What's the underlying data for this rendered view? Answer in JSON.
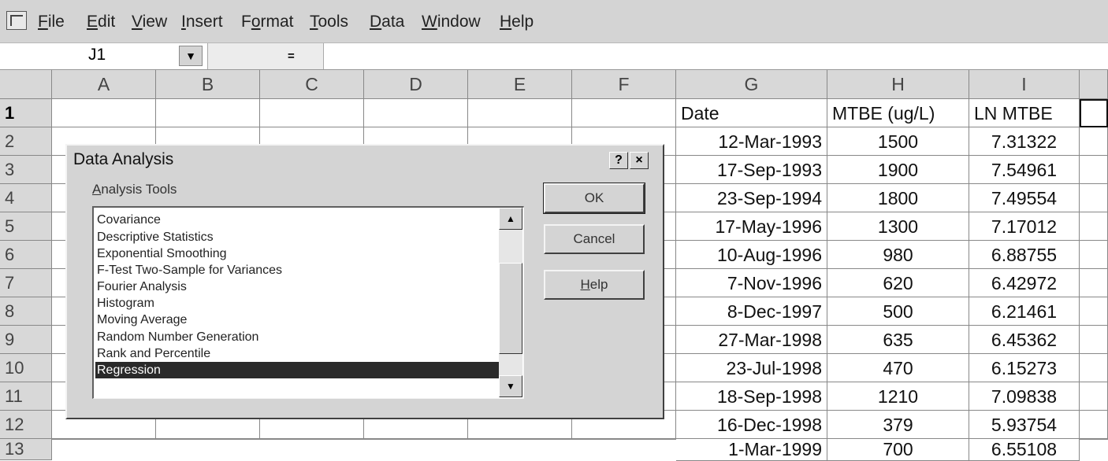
{
  "menubar": {
    "items": [
      "File",
      "Edit",
      "View",
      "Insert",
      "Format",
      "Tools",
      "Data",
      "Window",
      "Help"
    ],
    "mnemonics": [
      "F",
      "E",
      "V",
      "I",
      "o",
      "T",
      "D",
      "W",
      "H"
    ]
  },
  "formula_bar": {
    "name_box": "J1",
    "equals": "=",
    "value": ""
  },
  "grid": {
    "columns": [
      "A",
      "B",
      "C",
      "D",
      "E",
      "F",
      "G",
      "H",
      "I"
    ],
    "rows": [
      "1",
      "2",
      "3",
      "4",
      "5",
      "6",
      "7",
      "8",
      "9",
      "10",
      "11",
      "12",
      "13"
    ],
    "header_row": [
      "Date",
      "MTBE (ug/L)",
      "LN MTBE"
    ],
    "data": [
      [
        "12-Mar-1993",
        "1500",
        "7.31322"
      ],
      [
        "17-Sep-1993",
        "1900",
        "7.54961"
      ],
      [
        "23-Sep-1994",
        "1800",
        "7.49554"
      ],
      [
        "17-May-1996",
        "1300",
        "7.17012"
      ],
      [
        "10-Aug-1996",
        "980",
        "6.88755"
      ],
      [
        "7-Nov-1996",
        "620",
        "6.42972"
      ],
      [
        "8-Dec-1997",
        "500",
        "6.21461"
      ],
      [
        "27-Mar-1998",
        "635",
        "6.45362"
      ],
      [
        "23-Jul-1998",
        "470",
        "6.15273"
      ],
      [
        "18-Sep-1998",
        "1210",
        "7.09838"
      ],
      [
        "16-Dec-1998",
        "379",
        "5.93754"
      ],
      [
        "1-Mar-1999",
        "700",
        "6.55108"
      ]
    ]
  },
  "dialog": {
    "title": "Data Analysis",
    "help_button": "?",
    "close_button": "×",
    "list_label": "Analysis Tools",
    "tools": [
      "Covariance",
      "Descriptive Statistics",
      "Exponential Smoothing",
      "F-Test Two-Sample for Variances",
      "Fourier Analysis",
      "Histogram",
      "Moving Average",
      "Random Number Generation",
      "Rank and Percentile",
      "Regression"
    ],
    "selected_tool": "Regression",
    "ok": "OK",
    "cancel": "Cancel",
    "help": "Help"
  }
}
